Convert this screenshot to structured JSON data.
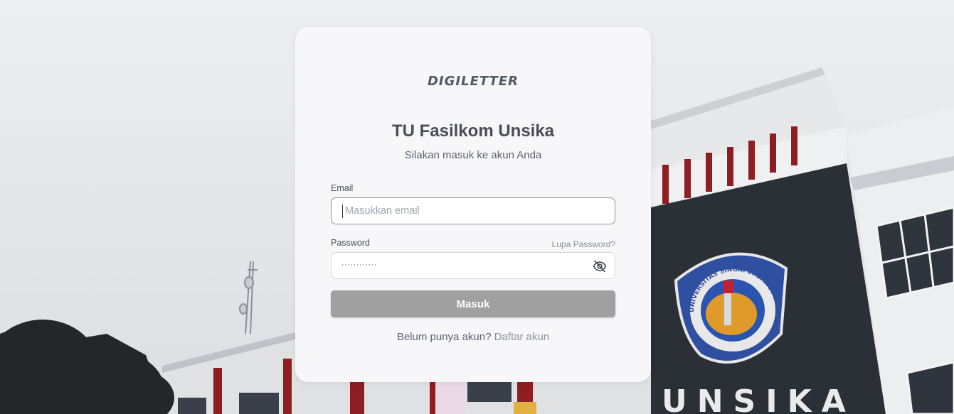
{
  "brand": {
    "logo": "DIGILETTER"
  },
  "login": {
    "title": "TU Fasilkom Unsika",
    "subtitle": "Silakan masuk ke akun Anda",
    "email_label": "Email",
    "email_placeholder": "Masukkan email",
    "email_value": "",
    "password_label": "Password",
    "forgot_link": "Lupa Password?",
    "password_masked": "············",
    "password_toggle_icon": "eye-slash-icon",
    "submit_label": "Masuk",
    "signup_prompt": "Belum punya akun?",
    "signup_link": "Daftar akun",
    "button_color": "#a0a0a0"
  },
  "background": {
    "emblem_text": "UNIVERSITAS SINGAPERBANGSA KARAWANG",
    "building_sign": "UNSIKA"
  }
}
